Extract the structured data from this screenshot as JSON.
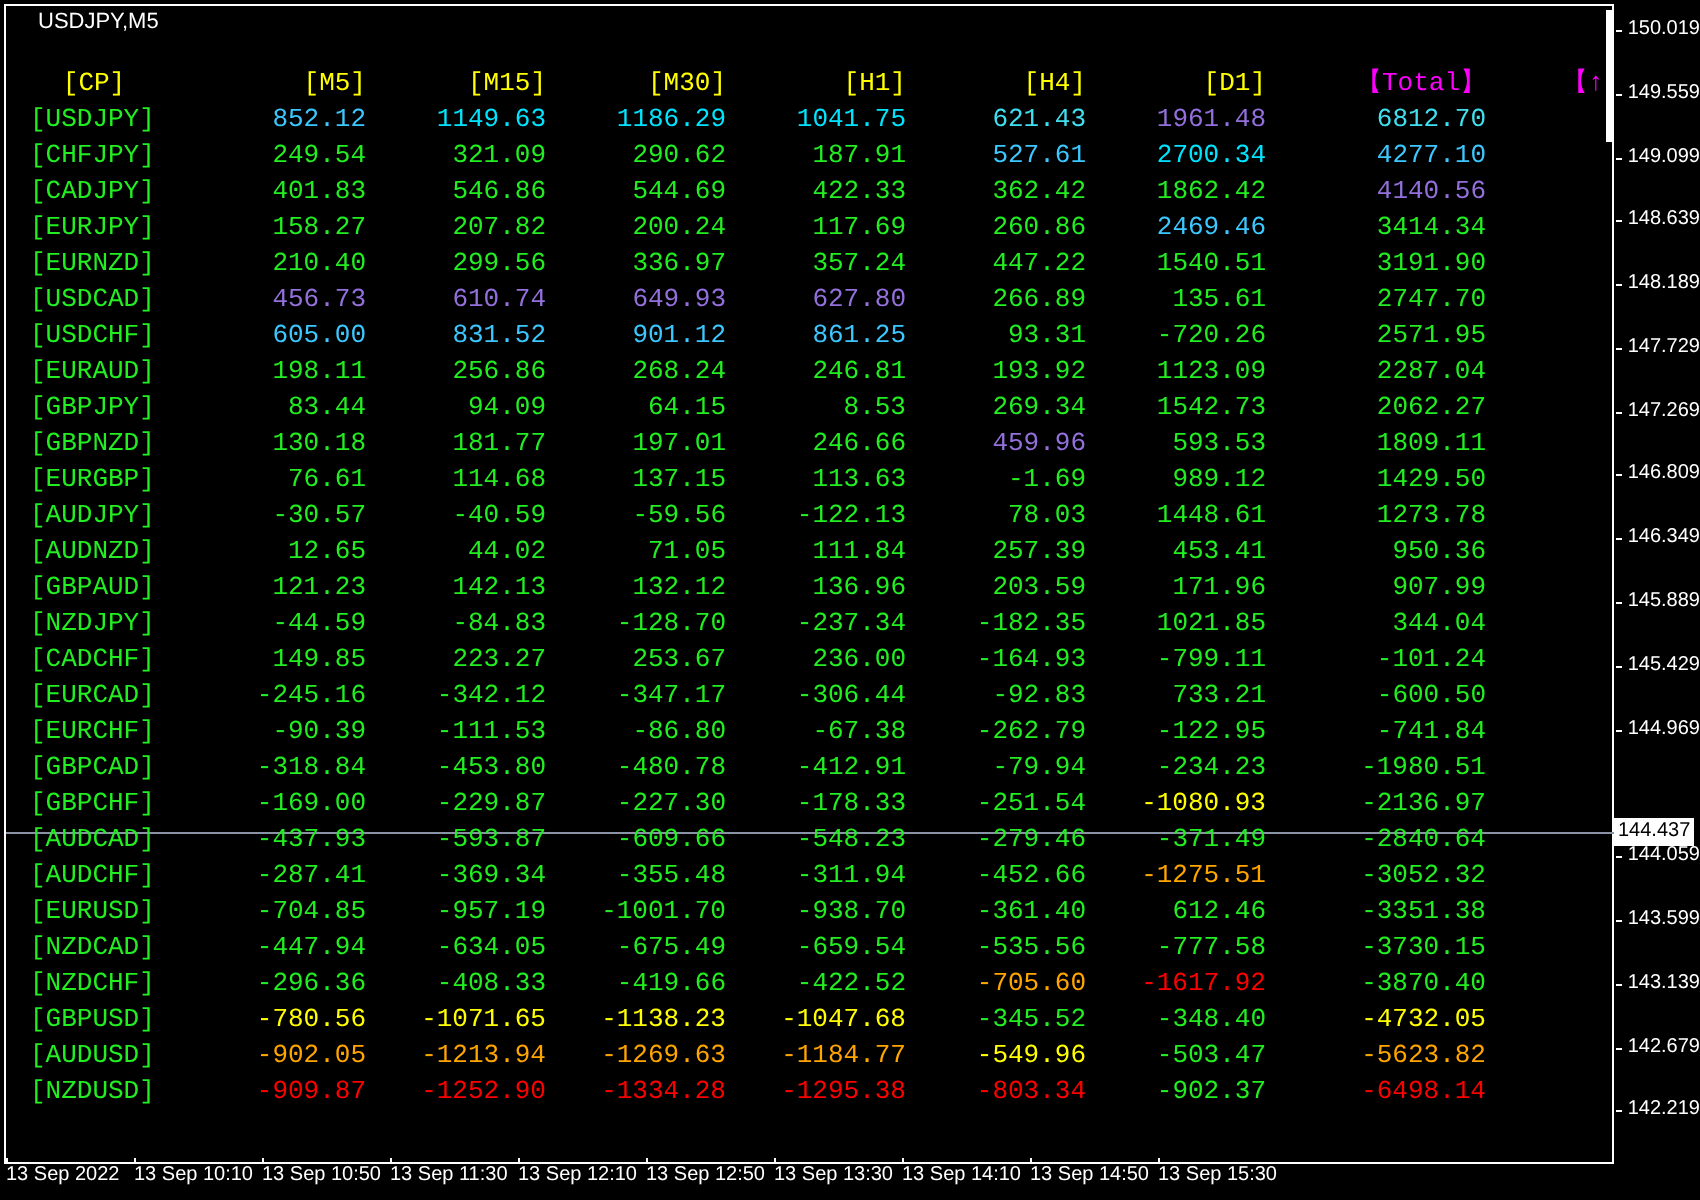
{
  "chart": {
    "title": "USDJPY,M5"
  },
  "table": {
    "headers": [
      {
        "text": "[CP]",
        "kind": "pair"
      },
      {
        "text": "[M5]",
        "kind": "timeframe"
      },
      {
        "text": "[M15]",
        "kind": "timeframe"
      },
      {
        "text": "[M30]",
        "kind": "timeframe"
      },
      {
        "text": "[H1]",
        "kind": "timeframe"
      },
      {
        "text": "[H4]",
        "kind": "timeframe"
      },
      {
        "text": "[D1]",
        "kind": "timeframe"
      },
      {
        "text": "【Total】",
        "kind": "total"
      },
      {
        "text": "【↑",
        "kind": "total"
      }
    ],
    "rows": [
      {
        "pair": "[USDJPY]",
        "values": [
          {
            "text": "852.12",
            "color": "#3cc8ff"
          },
          {
            "text": "1149.63",
            "color": "#00e5ff"
          },
          {
            "text": "1186.29",
            "color": "#00e5ff"
          },
          {
            "text": "1041.75",
            "color": "#00e5ff"
          },
          {
            "text": "621.43",
            "color": "#40e0f0"
          },
          {
            "text": "1961.48",
            "color": "#9370db"
          },
          {
            "text": "6812.70",
            "color": "#40e0f0"
          }
        ]
      },
      {
        "pair": "[CHFJPY]",
        "values": [
          {
            "text": "249.54",
            "color": "#22ee22"
          },
          {
            "text": "321.09",
            "color": "#22ee22"
          },
          {
            "text": "290.62",
            "color": "#22ee22"
          },
          {
            "text": "187.91",
            "color": "#22ee22"
          },
          {
            "text": "527.61",
            "color": "#3cc8ff"
          },
          {
            "text": "2700.34",
            "color": "#00e5ff"
          },
          {
            "text": "4277.10",
            "color": "#3cc8ff"
          }
        ]
      },
      {
        "pair": "[CADJPY]",
        "values": [
          {
            "text": "401.83",
            "color": "#22ee22"
          },
          {
            "text": "546.86",
            "color": "#22ee22"
          },
          {
            "text": "544.69",
            "color": "#22ee22"
          },
          {
            "text": "422.33",
            "color": "#22ee22"
          },
          {
            "text": "362.42",
            "color": "#22ee22"
          },
          {
            "text": "1862.42",
            "color": "#22ee22"
          },
          {
            "text": "4140.56",
            "color": "#9370db"
          }
        ]
      },
      {
        "pair": "[EURJPY]",
        "values": [
          {
            "text": "158.27",
            "color": "#22ee22"
          },
          {
            "text": "207.82",
            "color": "#22ee22"
          },
          {
            "text": "200.24",
            "color": "#22ee22"
          },
          {
            "text": "117.69",
            "color": "#22ee22"
          },
          {
            "text": "260.86",
            "color": "#22ee22"
          },
          {
            "text": "2469.46",
            "color": "#3cc8ff"
          },
          {
            "text": "3414.34",
            "color": "#22ee22"
          }
        ]
      },
      {
        "pair": "[EURNZD]",
        "values": [
          {
            "text": "210.40",
            "color": "#22ee22"
          },
          {
            "text": "299.56",
            "color": "#22ee22"
          },
          {
            "text": "336.97",
            "color": "#22ee22"
          },
          {
            "text": "357.24",
            "color": "#22ee22"
          },
          {
            "text": "447.22",
            "color": "#22ee22"
          },
          {
            "text": "1540.51",
            "color": "#22ee22"
          },
          {
            "text": "3191.90",
            "color": "#22ee22"
          }
        ]
      },
      {
        "pair": "[USDCAD]",
        "values": [
          {
            "text": "456.73",
            "color": "#9370db"
          },
          {
            "text": "610.74",
            "color": "#9370db"
          },
          {
            "text": "649.93",
            "color": "#9370db"
          },
          {
            "text": "627.80",
            "color": "#9370db"
          },
          {
            "text": "266.89",
            "color": "#22ee22"
          },
          {
            "text": "135.61",
            "color": "#22ee22"
          },
          {
            "text": "2747.70",
            "color": "#22ee22"
          }
        ]
      },
      {
        "pair": "[USDCHF]",
        "values": [
          {
            "text": "605.00",
            "color": "#3cc8ff"
          },
          {
            "text": "831.52",
            "color": "#3cc8ff"
          },
          {
            "text": "901.12",
            "color": "#3cc8ff"
          },
          {
            "text": "861.25",
            "color": "#3cc8ff"
          },
          {
            "text": "93.31",
            "color": "#22ee22"
          },
          {
            "text": "-720.26",
            "color": "#22ee22"
          },
          {
            "text": "2571.95",
            "color": "#22ee22"
          }
        ]
      },
      {
        "pair": "[EURAUD]",
        "values": [
          {
            "text": "198.11",
            "color": "#22ee22"
          },
          {
            "text": "256.86",
            "color": "#22ee22"
          },
          {
            "text": "268.24",
            "color": "#22ee22"
          },
          {
            "text": "246.81",
            "color": "#22ee22"
          },
          {
            "text": "193.92",
            "color": "#22ee22"
          },
          {
            "text": "1123.09",
            "color": "#22ee22"
          },
          {
            "text": "2287.04",
            "color": "#22ee22"
          }
        ]
      },
      {
        "pair": "[GBPJPY]",
        "values": [
          {
            "text": "83.44",
            "color": "#22ee22"
          },
          {
            "text": "94.09",
            "color": "#22ee22"
          },
          {
            "text": "64.15",
            "color": "#22ee22"
          },
          {
            "text": "8.53",
            "color": "#22ee22"
          },
          {
            "text": "269.34",
            "color": "#22ee22"
          },
          {
            "text": "1542.73",
            "color": "#22ee22"
          },
          {
            "text": "2062.27",
            "color": "#22ee22"
          }
        ]
      },
      {
        "pair": "[GBPNZD]",
        "values": [
          {
            "text": "130.18",
            "color": "#22ee22"
          },
          {
            "text": "181.77",
            "color": "#22ee22"
          },
          {
            "text": "197.01",
            "color": "#22ee22"
          },
          {
            "text": "246.66",
            "color": "#22ee22"
          },
          {
            "text": "459.96",
            "color": "#9370db"
          },
          {
            "text": "593.53",
            "color": "#22ee22"
          },
          {
            "text": "1809.11",
            "color": "#22ee22"
          }
        ]
      },
      {
        "pair": "[EURGBP]",
        "values": [
          {
            "text": "76.61",
            "color": "#22ee22"
          },
          {
            "text": "114.68",
            "color": "#22ee22"
          },
          {
            "text": "137.15",
            "color": "#22ee22"
          },
          {
            "text": "113.63",
            "color": "#22ee22"
          },
          {
            "text": "-1.69",
            "color": "#22ee22"
          },
          {
            "text": "989.12",
            "color": "#22ee22"
          },
          {
            "text": "1429.50",
            "color": "#22ee22"
          }
        ]
      },
      {
        "pair": "[AUDJPY]",
        "values": [
          {
            "text": "-30.57",
            "color": "#22ee22"
          },
          {
            "text": "-40.59",
            "color": "#22ee22"
          },
          {
            "text": "-59.56",
            "color": "#22ee22"
          },
          {
            "text": "-122.13",
            "color": "#22ee22"
          },
          {
            "text": "78.03",
            "color": "#22ee22"
          },
          {
            "text": "1448.61",
            "color": "#22ee22"
          },
          {
            "text": "1273.78",
            "color": "#22ee22"
          }
        ]
      },
      {
        "pair": "[AUDNZD]",
        "values": [
          {
            "text": "12.65",
            "color": "#22ee22"
          },
          {
            "text": "44.02",
            "color": "#22ee22"
          },
          {
            "text": "71.05",
            "color": "#22ee22"
          },
          {
            "text": "111.84",
            "color": "#22ee22"
          },
          {
            "text": "257.39",
            "color": "#22ee22"
          },
          {
            "text": "453.41",
            "color": "#22ee22"
          },
          {
            "text": "950.36",
            "color": "#22ee22"
          }
        ]
      },
      {
        "pair": "[GBPAUD]",
        "values": [
          {
            "text": "121.23",
            "color": "#22ee22"
          },
          {
            "text": "142.13",
            "color": "#22ee22"
          },
          {
            "text": "132.12",
            "color": "#22ee22"
          },
          {
            "text": "136.96",
            "color": "#22ee22"
          },
          {
            "text": "203.59",
            "color": "#22ee22"
          },
          {
            "text": "171.96",
            "color": "#22ee22"
          },
          {
            "text": "907.99",
            "color": "#22ee22"
          }
        ]
      },
      {
        "pair": "[NZDJPY]",
        "values": [
          {
            "text": "-44.59",
            "color": "#22ee22"
          },
          {
            "text": "-84.83",
            "color": "#22ee22"
          },
          {
            "text": "-128.70",
            "color": "#22ee22"
          },
          {
            "text": "-237.34",
            "color": "#22ee22"
          },
          {
            "text": "-182.35",
            "color": "#22ee22"
          },
          {
            "text": "1021.85",
            "color": "#22ee22"
          },
          {
            "text": "344.04",
            "color": "#22ee22"
          }
        ]
      },
      {
        "pair": "[CADCHF]",
        "values": [
          {
            "text": "149.85",
            "color": "#22ee22"
          },
          {
            "text": "223.27",
            "color": "#22ee22"
          },
          {
            "text": "253.67",
            "color": "#22ee22"
          },
          {
            "text": "236.00",
            "color": "#22ee22"
          },
          {
            "text": "-164.93",
            "color": "#22ee22"
          },
          {
            "text": "-799.11",
            "color": "#22ee22"
          },
          {
            "text": "-101.24",
            "color": "#22ee22"
          }
        ]
      },
      {
        "pair": "[EURCAD]",
        "values": [
          {
            "text": "-245.16",
            "color": "#22ee22"
          },
          {
            "text": "-342.12",
            "color": "#22ee22"
          },
          {
            "text": "-347.17",
            "color": "#22ee22"
          },
          {
            "text": "-306.44",
            "color": "#22ee22"
          },
          {
            "text": "-92.83",
            "color": "#22ee22"
          },
          {
            "text": "733.21",
            "color": "#22ee22"
          },
          {
            "text": "-600.50",
            "color": "#22ee22"
          }
        ]
      },
      {
        "pair": "[EURCHF]",
        "values": [
          {
            "text": "-90.39",
            "color": "#22ee22"
          },
          {
            "text": "-111.53",
            "color": "#22ee22"
          },
          {
            "text": "-86.80",
            "color": "#22ee22"
          },
          {
            "text": "-67.38",
            "color": "#22ee22"
          },
          {
            "text": "-262.79",
            "color": "#22ee22"
          },
          {
            "text": "-122.95",
            "color": "#22ee22"
          },
          {
            "text": "-741.84",
            "color": "#22ee22"
          }
        ]
      },
      {
        "pair": "[GBPCAD]",
        "values": [
          {
            "text": "-318.84",
            "color": "#22ee22"
          },
          {
            "text": "-453.80",
            "color": "#22ee22"
          },
          {
            "text": "-480.78",
            "color": "#22ee22"
          },
          {
            "text": "-412.91",
            "color": "#22ee22"
          },
          {
            "text": "-79.94",
            "color": "#22ee22"
          },
          {
            "text": "-234.23",
            "color": "#22ee22"
          },
          {
            "text": "-1980.51",
            "color": "#22ee22"
          }
        ]
      },
      {
        "pair": "[GBPCHF]",
        "values": [
          {
            "text": "-169.00",
            "color": "#22ee22"
          },
          {
            "text": "-229.87",
            "color": "#22ee22"
          },
          {
            "text": "-227.30",
            "color": "#22ee22"
          },
          {
            "text": "-178.33",
            "color": "#22ee22"
          },
          {
            "text": "-251.54",
            "color": "#22ee22"
          },
          {
            "text": "-1080.93",
            "color": "#ffff00"
          },
          {
            "text": "-2136.97",
            "color": "#22ee22"
          }
        ]
      },
      {
        "pair": "[AUDCAD]",
        "values": [
          {
            "text": "-437.93",
            "color": "#22ee22"
          },
          {
            "text": "-593.87",
            "color": "#22ee22"
          },
          {
            "text": "-609.66",
            "color": "#22ee22"
          },
          {
            "text": "-548.23",
            "color": "#22ee22"
          },
          {
            "text": "-279.46",
            "color": "#22ee22"
          },
          {
            "text": "-371.49",
            "color": "#22ee22"
          },
          {
            "text": "-2840.64",
            "color": "#22ee22"
          }
        ]
      },
      {
        "pair": "[AUDCHF]",
        "values": [
          {
            "text": "-287.41",
            "color": "#22ee22"
          },
          {
            "text": "-369.34",
            "color": "#22ee22"
          },
          {
            "text": "-355.48",
            "color": "#22ee22"
          },
          {
            "text": "-311.94",
            "color": "#22ee22"
          },
          {
            "text": "-452.66",
            "color": "#22ee22"
          },
          {
            "text": "-1275.51",
            "color": "#ffa500"
          },
          {
            "text": "-3052.32",
            "color": "#22ee22"
          }
        ]
      },
      {
        "pair": "[EURUSD]",
        "values": [
          {
            "text": "-704.85",
            "color": "#22ee22"
          },
          {
            "text": "-957.19",
            "color": "#22ee22"
          },
          {
            "text": "-1001.70",
            "color": "#22ee22"
          },
          {
            "text": "-938.70",
            "color": "#22ee22"
          },
          {
            "text": "-361.40",
            "color": "#22ee22"
          },
          {
            "text": "612.46",
            "color": "#22ee22"
          },
          {
            "text": "-3351.38",
            "color": "#22ee22"
          }
        ]
      },
      {
        "pair": "[NZDCAD]",
        "values": [
          {
            "text": "-447.94",
            "color": "#22ee22"
          },
          {
            "text": "-634.05",
            "color": "#22ee22"
          },
          {
            "text": "-675.49",
            "color": "#22ee22"
          },
          {
            "text": "-659.54",
            "color": "#22ee22"
          },
          {
            "text": "-535.56",
            "color": "#22ee22"
          },
          {
            "text": "-777.58",
            "color": "#22ee22"
          },
          {
            "text": "-3730.15",
            "color": "#22ee22"
          }
        ]
      },
      {
        "pair": "[NZDCHF]",
        "values": [
          {
            "text": "-296.36",
            "color": "#22ee22"
          },
          {
            "text": "-408.33",
            "color": "#22ee22"
          },
          {
            "text": "-419.66",
            "color": "#22ee22"
          },
          {
            "text": "-422.52",
            "color": "#22ee22"
          },
          {
            "text": "-705.60",
            "color": "#ffa500"
          },
          {
            "text": "-1617.92",
            "color": "#ff0000"
          },
          {
            "text": "-3870.40",
            "color": "#22ee22"
          }
        ]
      },
      {
        "pair": "[GBPUSD]",
        "values": [
          {
            "text": "-780.56",
            "color": "#ffff00"
          },
          {
            "text": "-1071.65",
            "color": "#ffff00"
          },
          {
            "text": "-1138.23",
            "color": "#ffff00"
          },
          {
            "text": "-1047.68",
            "color": "#ffff00"
          },
          {
            "text": "-345.52",
            "color": "#22ee22"
          },
          {
            "text": "-348.40",
            "color": "#22ee22"
          },
          {
            "text": "-4732.05",
            "color": "#ffff00"
          }
        ]
      },
      {
        "pair": "[AUDUSD]",
        "values": [
          {
            "text": "-902.05",
            "color": "#ffa500"
          },
          {
            "text": "-1213.94",
            "color": "#ffa500"
          },
          {
            "text": "-1269.63",
            "color": "#ffa500"
          },
          {
            "text": "-1184.77",
            "color": "#ffa500"
          },
          {
            "text": "-549.96",
            "color": "#ffff00"
          },
          {
            "text": "-503.47",
            "color": "#22ee22"
          },
          {
            "text": "-5623.82",
            "color": "#ffa500"
          }
        ]
      },
      {
        "pair": "[NZDUSD]",
        "values": [
          {
            "text": "-909.87",
            "color": "#ff0000"
          },
          {
            "text": "-1252.90",
            "color": "#ff0000"
          },
          {
            "text": "-1334.28",
            "color": "#ff0000"
          },
          {
            "text": "-1295.38",
            "color": "#ff0000"
          },
          {
            "text": "-803.34",
            "color": "#ff0000"
          },
          {
            "text": "-902.37",
            "color": "#22ee22"
          },
          {
            "text": "-6498.14",
            "color": "#ff0000"
          }
        ]
      }
    ]
  },
  "price_axis": [
    "150.019",
    "149.559",
    "149.099",
    "148.639",
    "148.189",
    "147.729",
    "147.269",
    "146.809",
    "146.349",
    "145.889",
    "145.429",
    "144.969",
    "144.059",
    "143.599",
    "143.139",
    "142.679",
    "142.219"
  ],
  "crosshair": {
    "price": "144.437"
  },
  "time_axis": [
    "13 Sep 2022",
    "13 Sep 10:10",
    "13 Sep 10:50",
    "13 Sep 11:30",
    "13 Sep 12:10",
    "13 Sep 12:50",
    "13 Sep 13:30",
    "13 Sep 14:10",
    "13 Sep 14:50",
    "13 Sep 15:30"
  ]
}
